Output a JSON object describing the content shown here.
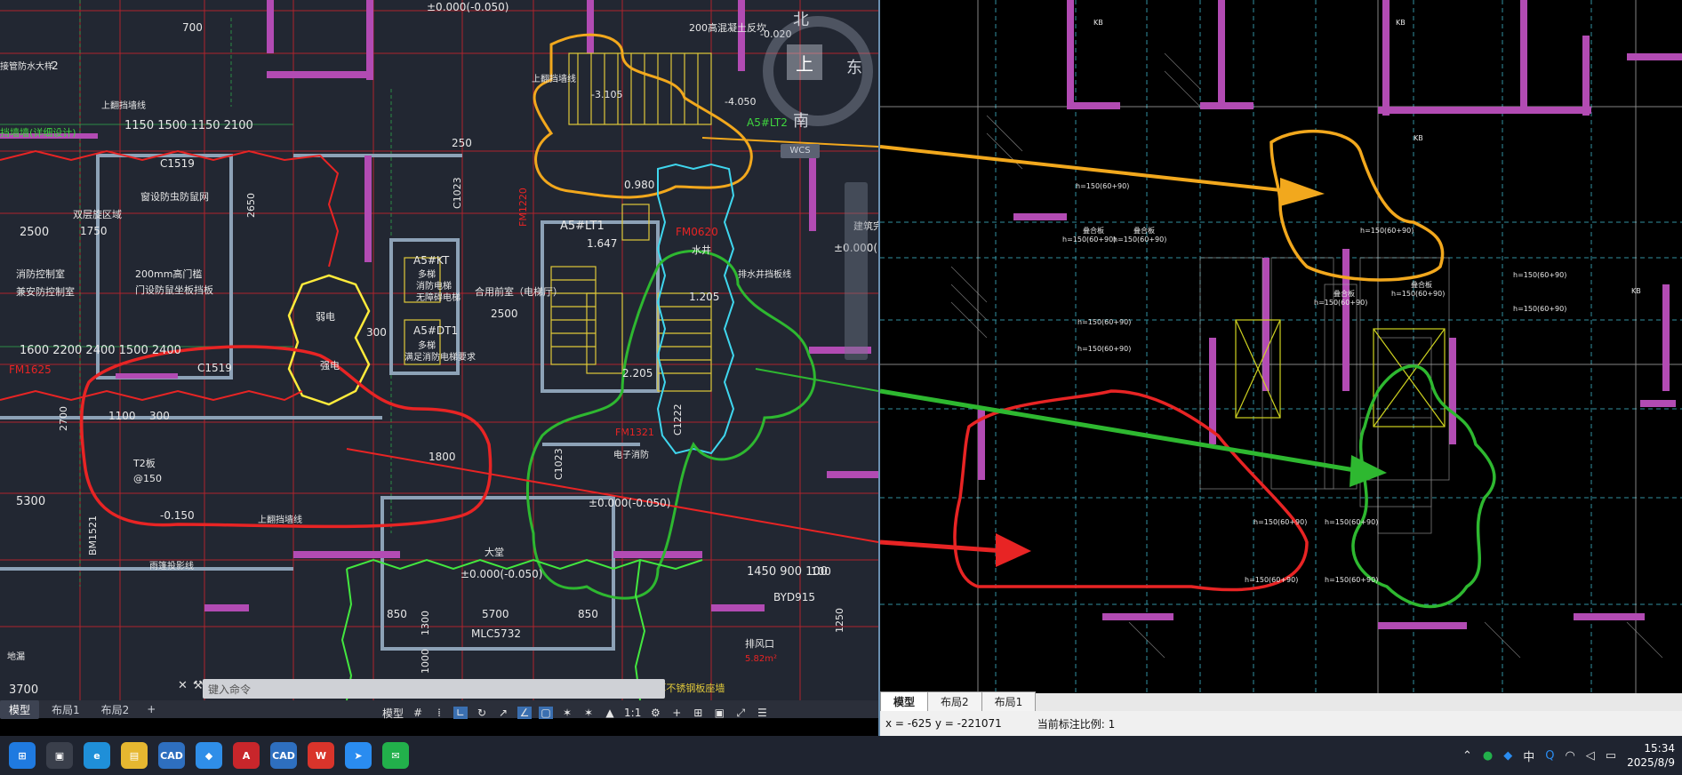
{
  "left_drawing": {
    "labels": {
      "elev_top": "±0.000(-0.050)",
      "dim_700": "700",
      "stair_200": "200高混凝土反坎",
      "elev_0020": "-0.020",
      "north": "北",
      "east": "东",
      "south": "南",
      "top_face": "上",
      "wcs": "WCS",
      "drain_well": "接管防水大样",
      "mark_2": "2",
      "up_flip_beam": "上翻挡墙线",
      "elev_3105": "-3.105",
      "elev_4050": "-4.050",
      "a5lt2": "A5#LT2",
      "dims_row1": "1150   1500   1150   2100",
      "green_note": "挡墙墙(详细设计)",
      "dim_250": "250",
      "c1519a": "C1519",
      "fire_proof_net": "窗设防虫防鼠网",
      "dim_2650": "2650",
      "fm1220": "FM1220",
      "c1023a": "C1023",
      "elev_0980": "0.980",
      "a5lt1": "A5#LT1",
      "elev_1647": "1.647",
      "fm0620": "FM0620",
      "water_well": "水井",
      "two_way_zone": "双层旋区域",
      "dim_1750": "1750",
      "dim_2500": "2500",
      "fire_control": "消防控制室",
      "security_room": "兼安防控制室",
      "door_200mm": "200mm高门槛",
      "door_note": "门设防鼠坐板挡板",
      "a5kt": "A5#KT",
      "kt_note1": "多梯",
      "kt_note2": "消防电梯",
      "kt_note3": "无障碍电梯",
      "lobby": "合用前室（电梯厅）",
      "dim_2500b": "2500",
      "a5dt1": "A5#DT1",
      "dt_note1": "多梯",
      "dt_note2": "满足消防电梯要求",
      "elev_1205": "1.205",
      "drain_line": "排水井挡板线",
      "weak_room": "弱电",
      "strong_room": "强电",
      "dims_row2": "1600   2200   2400   1500   2400",
      "c1519b": "C1519",
      "dim_300": "300",
      "fm1625": "FM1625",
      "elev_2205": "2.205",
      "c1222": "C1222",
      "dim_2700": "2700",
      "dim_1100": "1100",
      "dim_300b": "300",
      "dim_1800": "1800",
      "elev_0150a": "-0.150",
      "t2": "T2板",
      "t2sub": "@150",
      "dim_5300": "5300",
      "bm1521": "BM1521",
      "c1023b": "C1023",
      "elev_mid": "±0.000(-0.050)",
      "fm1321": "FM1321",
      "up_beam2": "上翻挡墙线",
      "awning": "雨篷投影线",
      "hall": "大堂",
      "elev_hall": "±0.000(-0.050)",
      "dims_row3": "1450   900   100",
      "byd": "BYD915",
      "dim_850a": "850",
      "dim_5700": "5700",
      "dim_850b": "850",
      "mlc": "MLC5732",
      "dim_1300": "1300",
      "dim_1000": "1000",
      "dim_1250": "1250",
      "cable": "排风口",
      "cable_area": "5.82m²",
      "side_note": "电子消防",
      "floor_drain": "地漏",
      "dim_3700": "3700",
      "dim_100": "100",
      "sink_note": "1mm厚不锈钢板座墙",
      "elev_right_edge": "±0.000(",
      "label_right_edge": "建筑完"
    },
    "command_placeholder": "键入命令",
    "command_hint": "1mm厚不锈钢板座墙",
    "tabs": [
      "模型",
      "布局1",
      "布局2"
    ],
    "active_tab": "模型",
    "status_model": "模型",
    "status_scale": "1:1"
  },
  "right_drawing": {
    "tabs": [
      "模型",
      "布局2",
      "布局1"
    ],
    "active_tab": "模型",
    "coords": "x = -625  y = -221071",
    "scale_label": "当前标注比例: 1",
    "slab_labels": {
      "s1": "h=150(60+90)",
      "s2": "h=150(60+90)",
      "s3": "h=150(60+90)",
      "s4": "h=150(60+90)",
      "s5": "h=150(60+90)",
      "s6": "h=150(60+90)",
      "s7": "h=150(60+90)",
      "s8": "h=150(60+90)",
      "s9": "h=150(60+90)",
      "s10": "h=150(60+90)",
      "s11": "h=150(60+90)",
      "s12": "h=150(60+90)",
      "s13": "h=150(60+90)",
      "s14": "h=150(60+90)"
    },
    "slab_title": "叠合板",
    "kb": "KB"
  },
  "taskbar": {
    "apps": [
      {
        "name": "start",
        "color": "#1f7ae0",
        "label": "⊞"
      },
      {
        "name": "task-view",
        "color": "#3a3f4b",
        "label": "▣"
      },
      {
        "name": "edge",
        "color": "#1f8fd8",
        "label": "e"
      },
      {
        "name": "file-explorer",
        "color": "#e6b730",
        "label": "▤"
      },
      {
        "name": "cad-app-1",
        "color": "#2e6fbf",
        "label": "CAD"
      },
      {
        "name": "feishu",
        "color": "#2f8ee8",
        "label": "◆"
      },
      {
        "name": "autocad",
        "color": "#c8262b",
        "label": "A"
      },
      {
        "name": "cad-app-2",
        "color": "#2e6fbf",
        "label": "CAD"
      },
      {
        "name": "wps",
        "color": "#d9342b",
        "label": "W"
      },
      {
        "name": "dingtalk",
        "color": "#2a8cf0",
        "label": "➤"
      },
      {
        "name": "wechat",
        "color": "#22b04b",
        "label": "✉"
      }
    ],
    "tray_ime": "中",
    "time": "15:34",
    "date": "2025/8/9"
  }
}
